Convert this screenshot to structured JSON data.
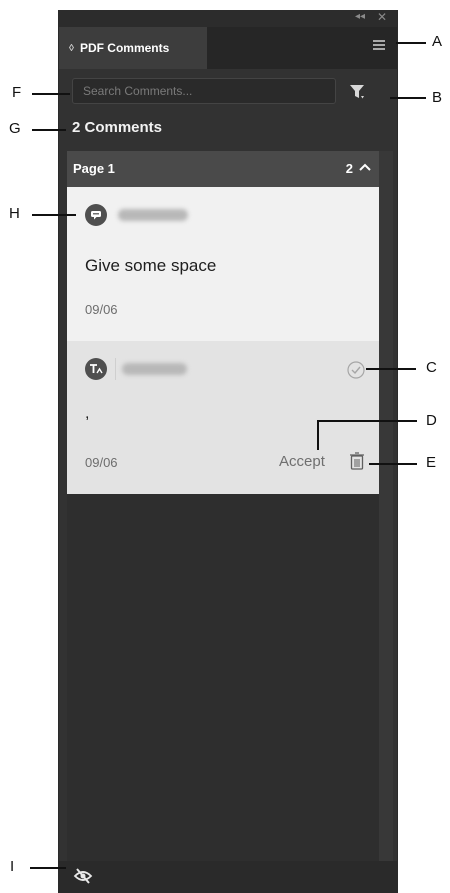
{
  "panel": {
    "tab_label": "PDF Comments",
    "search_placeholder": "Search Comments...",
    "comment_count": "2 Comments",
    "page_group": {
      "title": "Page 1",
      "count": "2"
    },
    "comments": [
      {
        "type_icon": "speech-bubble-icon",
        "text": "Give some space",
        "date": "09/06"
      },
      {
        "type_icon": "text-insert-icon",
        "text": ",",
        "date": "09/06",
        "action": "Accept"
      }
    ],
    "colors": {
      "panel_bg": "#323232",
      "card_bg": "#f1f1f1",
      "card2_bg": "#e3e3e3"
    }
  },
  "callouts": {
    "A": "A",
    "B": "B",
    "C": "C",
    "D": "D",
    "E": "E",
    "F": "F",
    "G": "G",
    "H": "H",
    "I": "I"
  }
}
